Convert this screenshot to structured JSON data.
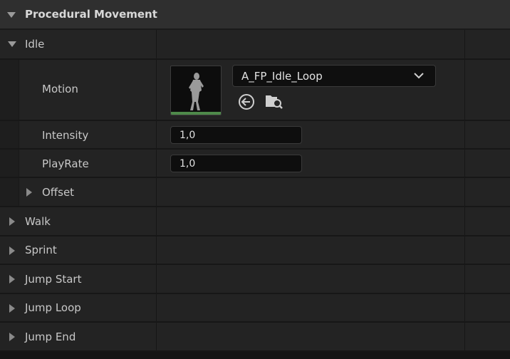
{
  "header": {
    "title": "Procedural Movement"
  },
  "idle": {
    "label": "Idle",
    "motion": {
      "label": "Motion",
      "asset": "A_FP_Idle_Loop"
    },
    "intensity": {
      "label": "Intensity",
      "value": "1,0"
    },
    "playrate": {
      "label": "PlayRate",
      "value": "1,0"
    },
    "offset": {
      "label": "Offset"
    }
  },
  "rows": {
    "walk": "Walk",
    "sprint": "Sprint",
    "jump_start": "Jump Start",
    "jump_loop": "Jump Loop",
    "jump_end": "Jump End"
  },
  "icons": {
    "use_selected": "arrow-left-circle-icon",
    "browse": "folder-search-icon"
  }
}
